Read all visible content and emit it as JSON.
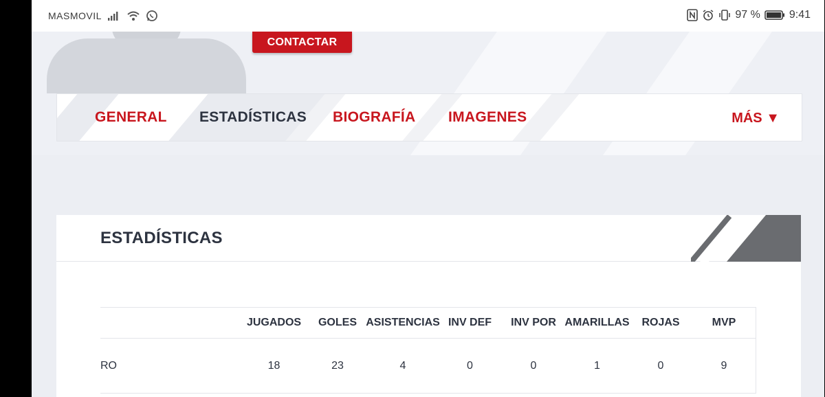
{
  "status_bar": {
    "carrier": "MASMOVIL",
    "battery": "97 %",
    "time": "9:41"
  },
  "profile": {
    "contact_label": "CONTACTAR"
  },
  "tabs": [
    {
      "label": "GENERAL"
    },
    {
      "label": "ESTADÍSTICAS"
    },
    {
      "label": "BIOGRAFÍA"
    },
    {
      "label": "IMAGENES"
    }
  ],
  "more_label": "MÁS ▼",
  "stats": {
    "title": "ESTADÍSTICAS",
    "columns": [
      "JUGADOS",
      "GOLES",
      "ASISTENCIAS",
      "INV DEF",
      "INV POR",
      "AMARILLAS",
      "ROJAS",
      "MVP"
    ],
    "rows": [
      {
        "name": "RO",
        "values": [
          "18",
          "23",
          "4",
          "0",
          "0",
          "1",
          "0",
          "9"
        ]
      }
    ]
  },
  "colors": {
    "accent": "#c8161e",
    "text_dark": "#2d3340",
    "page_bg": "#eceef3"
  }
}
